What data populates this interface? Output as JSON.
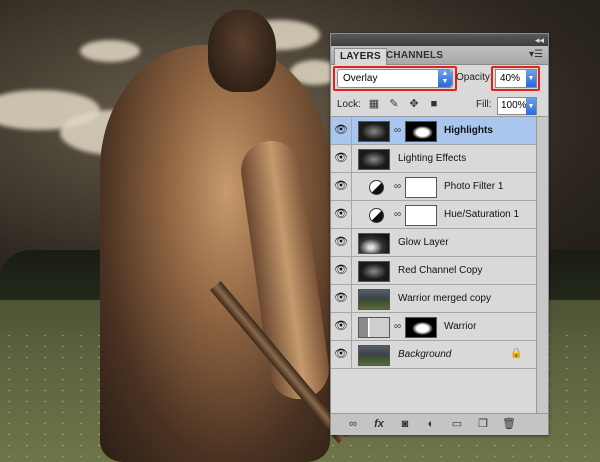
{
  "panel": {
    "tabs": [
      {
        "label": "LAYERS",
        "active": true
      },
      {
        "label": "CHANNELS",
        "active": false
      }
    ],
    "blend_mode": "Overlay",
    "opacity_label": "Opacity:",
    "opacity_value": "40%",
    "lock_label": "Lock:",
    "fill_label": "Fill:",
    "fill_value": "100%",
    "highlight_color": "#e2231a",
    "selected_row_color": "#a9c7ee",
    "layers": [
      {
        "name": "Highlights",
        "selected": true,
        "thumb": "dark",
        "mask": true
      },
      {
        "name": "Lighting Effects",
        "selected": false,
        "thumb": "dark",
        "mask": false
      },
      {
        "name": "Photo Filter 1",
        "selected": false,
        "adjustment": true,
        "mask": true
      },
      {
        "name": "Hue/Saturation 1",
        "selected": false,
        "adjustment": true,
        "mask": true
      },
      {
        "name": "Glow Layer",
        "selected": false,
        "thumb": "glow"
      },
      {
        "name": "Red Channel Copy",
        "selected": false,
        "thumb": "dark"
      },
      {
        "name": "Warrior merged copy",
        "selected": false,
        "thumb": "scene"
      },
      {
        "name": "Warrior",
        "selected": false,
        "thumb": "warrior",
        "mask": true
      },
      {
        "name": "Background",
        "selected": false,
        "thumb": "scene",
        "locked": true
      }
    ],
    "bottom_icons": [
      "link-icon",
      "fx-icon",
      "add-mask-icon",
      "adjustment-layer-icon",
      "new-group-icon",
      "new-layer-icon",
      "trash-icon"
    ]
  }
}
